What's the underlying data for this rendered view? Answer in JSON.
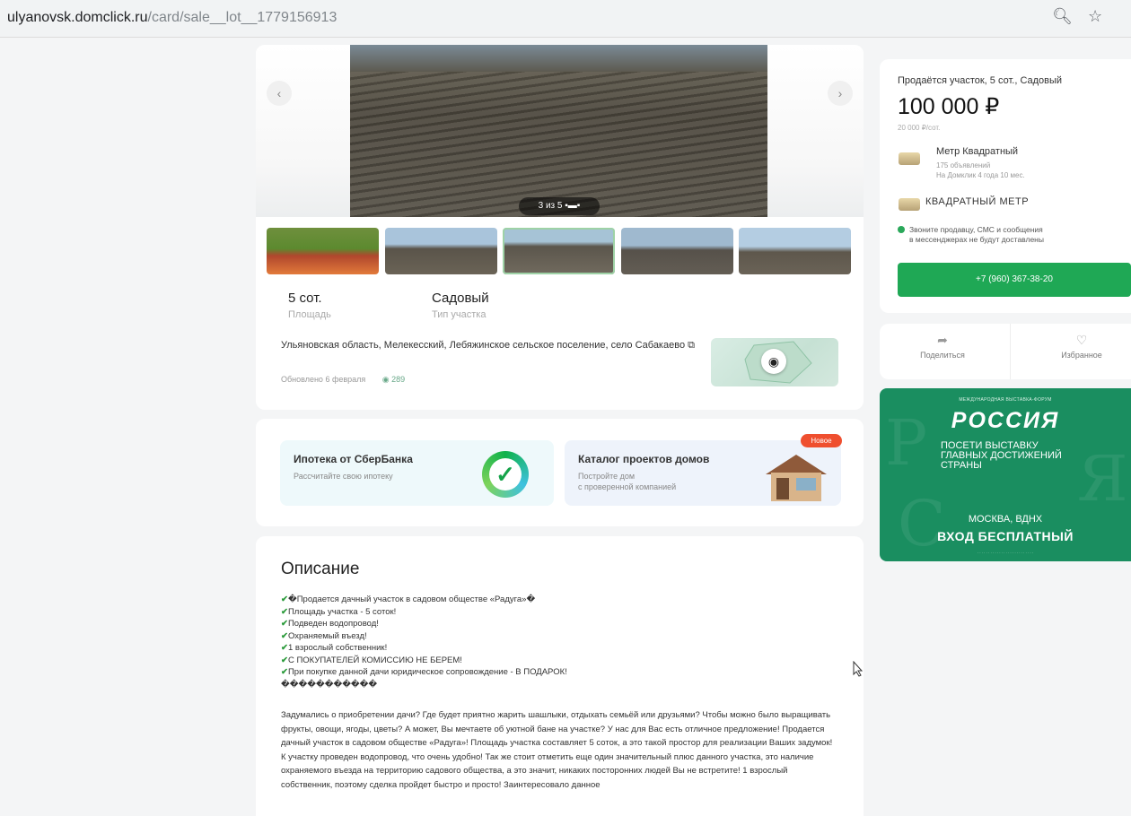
{
  "browser": {
    "url_host": "ulyanovsk.domclick.ru",
    "url_path": "/card/sale__lot__1779156913",
    "zoom_icon": "zoom-icon",
    "bookmark_icon": "star-icon"
  },
  "gallery": {
    "counter": "3 из 5",
    "prev_icon": "chevron-left-icon",
    "next_icon": "chevron-right-icon",
    "thumb_count": 5,
    "selected_thumb": 3
  },
  "params": [
    {
      "value": "5 сот.",
      "label": "Площадь"
    },
    {
      "value": "Садовый",
      "label": "Тип участка"
    }
  ],
  "address": "Ульяновская область, Мелекесский, Лебяжинское сельское поселение, село Сабакаево",
  "updated": "Обновлено 6 февраля",
  "views": "289",
  "promo": {
    "mortgage_title": "Ипотека от СберБанка",
    "mortgage_sub": "Рассчитайте свою ипотеку",
    "catalog_title": "Каталог проектов домов",
    "catalog_sub_1": "Постройте дом",
    "catalog_sub_2": "с проверенной компанией",
    "new_badge": "Новое"
  },
  "description": {
    "title": "Описание",
    "bullets": [
      "�Продается дачный участок в садовом обществе «Радуга»�",
      "Площадь участка - 5 соток!",
      "Подведен водопровод!",
      "Охраняемый въезд!",
      "1 взрослый собственник!",
      "С ПОКУПАТЕЛЕЙ КОМИССИЮ НЕ БЕРЕМ!",
      "При покупке данной дачи юридическое сопровождение - В ПОДАРОК!"
    ],
    "symbols_line": "�����������",
    "paragraph": "Задумались о приобретении дачи? Где будет приятно жарить шашлыки, отдыхать семьёй или друзьями? Чтобы можно было выращивать фрукты, овощи, ягоды, цветы? А может, Вы мечтаете об уютной бане на участке? У нас для Вас есть отличное предложение! Продается дачный участок в садовом обществе «Радуга»! Площадь участка составляет 5 соток, а это такой простор для реализации Ваших задумок! К участку проведен водопровод, что очень удобно! Так же стоит отметить еще один значительный плюс данного участка, это наличие охраняемого въезда на территорию садового общества, а это значит, никаких посторонних людей Вы не встретите! 1 взрослый собственник, поэтому сделка пройдет быстро и просто! Заинтересовало данное"
  },
  "listing": {
    "title": "Продаётся участок, 5 сот., Садовый",
    "price": "100 000 ₽",
    "per_unit": "20 000 ₽/сот.",
    "seller_name": "Метр Квадратный",
    "seller_listings": "175 объявлений",
    "seller_since": "На Домклик 4 года 10 мес.",
    "agency_name": "КВАДРАТНЫЙ МЕТР",
    "notice_1": "Звоните продавцу, СМС и сообщения",
    "notice_2": "в мессенджерах не будут доставлены",
    "phone": "+7 (960) 367-38-20"
  },
  "actions": {
    "share": "Поделиться",
    "favorite": "Избранное",
    "share_icon": "share-icon",
    "favorite_icon": "heart-icon"
  },
  "ad": {
    "top_line": "МЕЖДУНАРОДНАЯ ВЫСТАВКА-ФОРУМ",
    "logo": "РОССИЯ",
    "headline_1": "ПОСЕТИ ВЫСТАВКУ",
    "headline_2": "ГЛАВНЫХ ДОСТИЖЕНИЙ",
    "headline_3": "СТРАНЫ",
    "place": "МОСКВА, ВДНХ",
    "free": "ВХОД БЕСПЛАТНЫЙ"
  },
  "colors": {
    "accent_green": "#1fa855",
    "ad_green": "#1a8e60",
    "badge_red": "#ef4f2f"
  }
}
